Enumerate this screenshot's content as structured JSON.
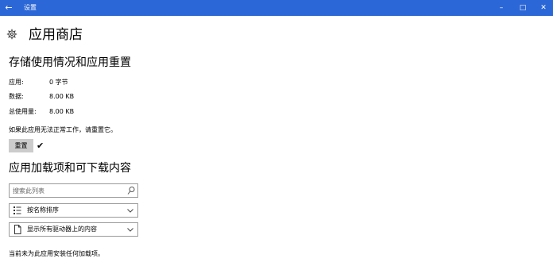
{
  "window": {
    "title": "设置",
    "back_glyph": "←",
    "minimize_glyph": "–",
    "maximize_glyph": "□",
    "close_glyph": "✕"
  },
  "page": {
    "title": "应用商店",
    "icon": "gear-icon"
  },
  "storage": {
    "heading": "存储使用情况和应用重置",
    "rows": [
      {
        "label": "应用:",
        "value": "0 字节"
      },
      {
        "label": "数据:",
        "value": "8.00 KB"
      },
      {
        "label": "总使用量:",
        "value": "8.00 KB"
      }
    ],
    "reset_note": "如果此应用无法正常工作，请重置它。",
    "reset_label": "重置",
    "reset_done_glyph": "✔"
  },
  "addons": {
    "heading": "应用加载项和可下载内容",
    "search_placeholder": "搜索此列表",
    "sort_label": "按名称排序",
    "filter_label": "显示所有驱动器上的内容",
    "empty_message": "当前未为此应用安装任何加载项。"
  },
  "colors": {
    "titlebar": "#2b67d6",
    "button_bg": "#cccccc",
    "border": "#9a9a9a"
  }
}
